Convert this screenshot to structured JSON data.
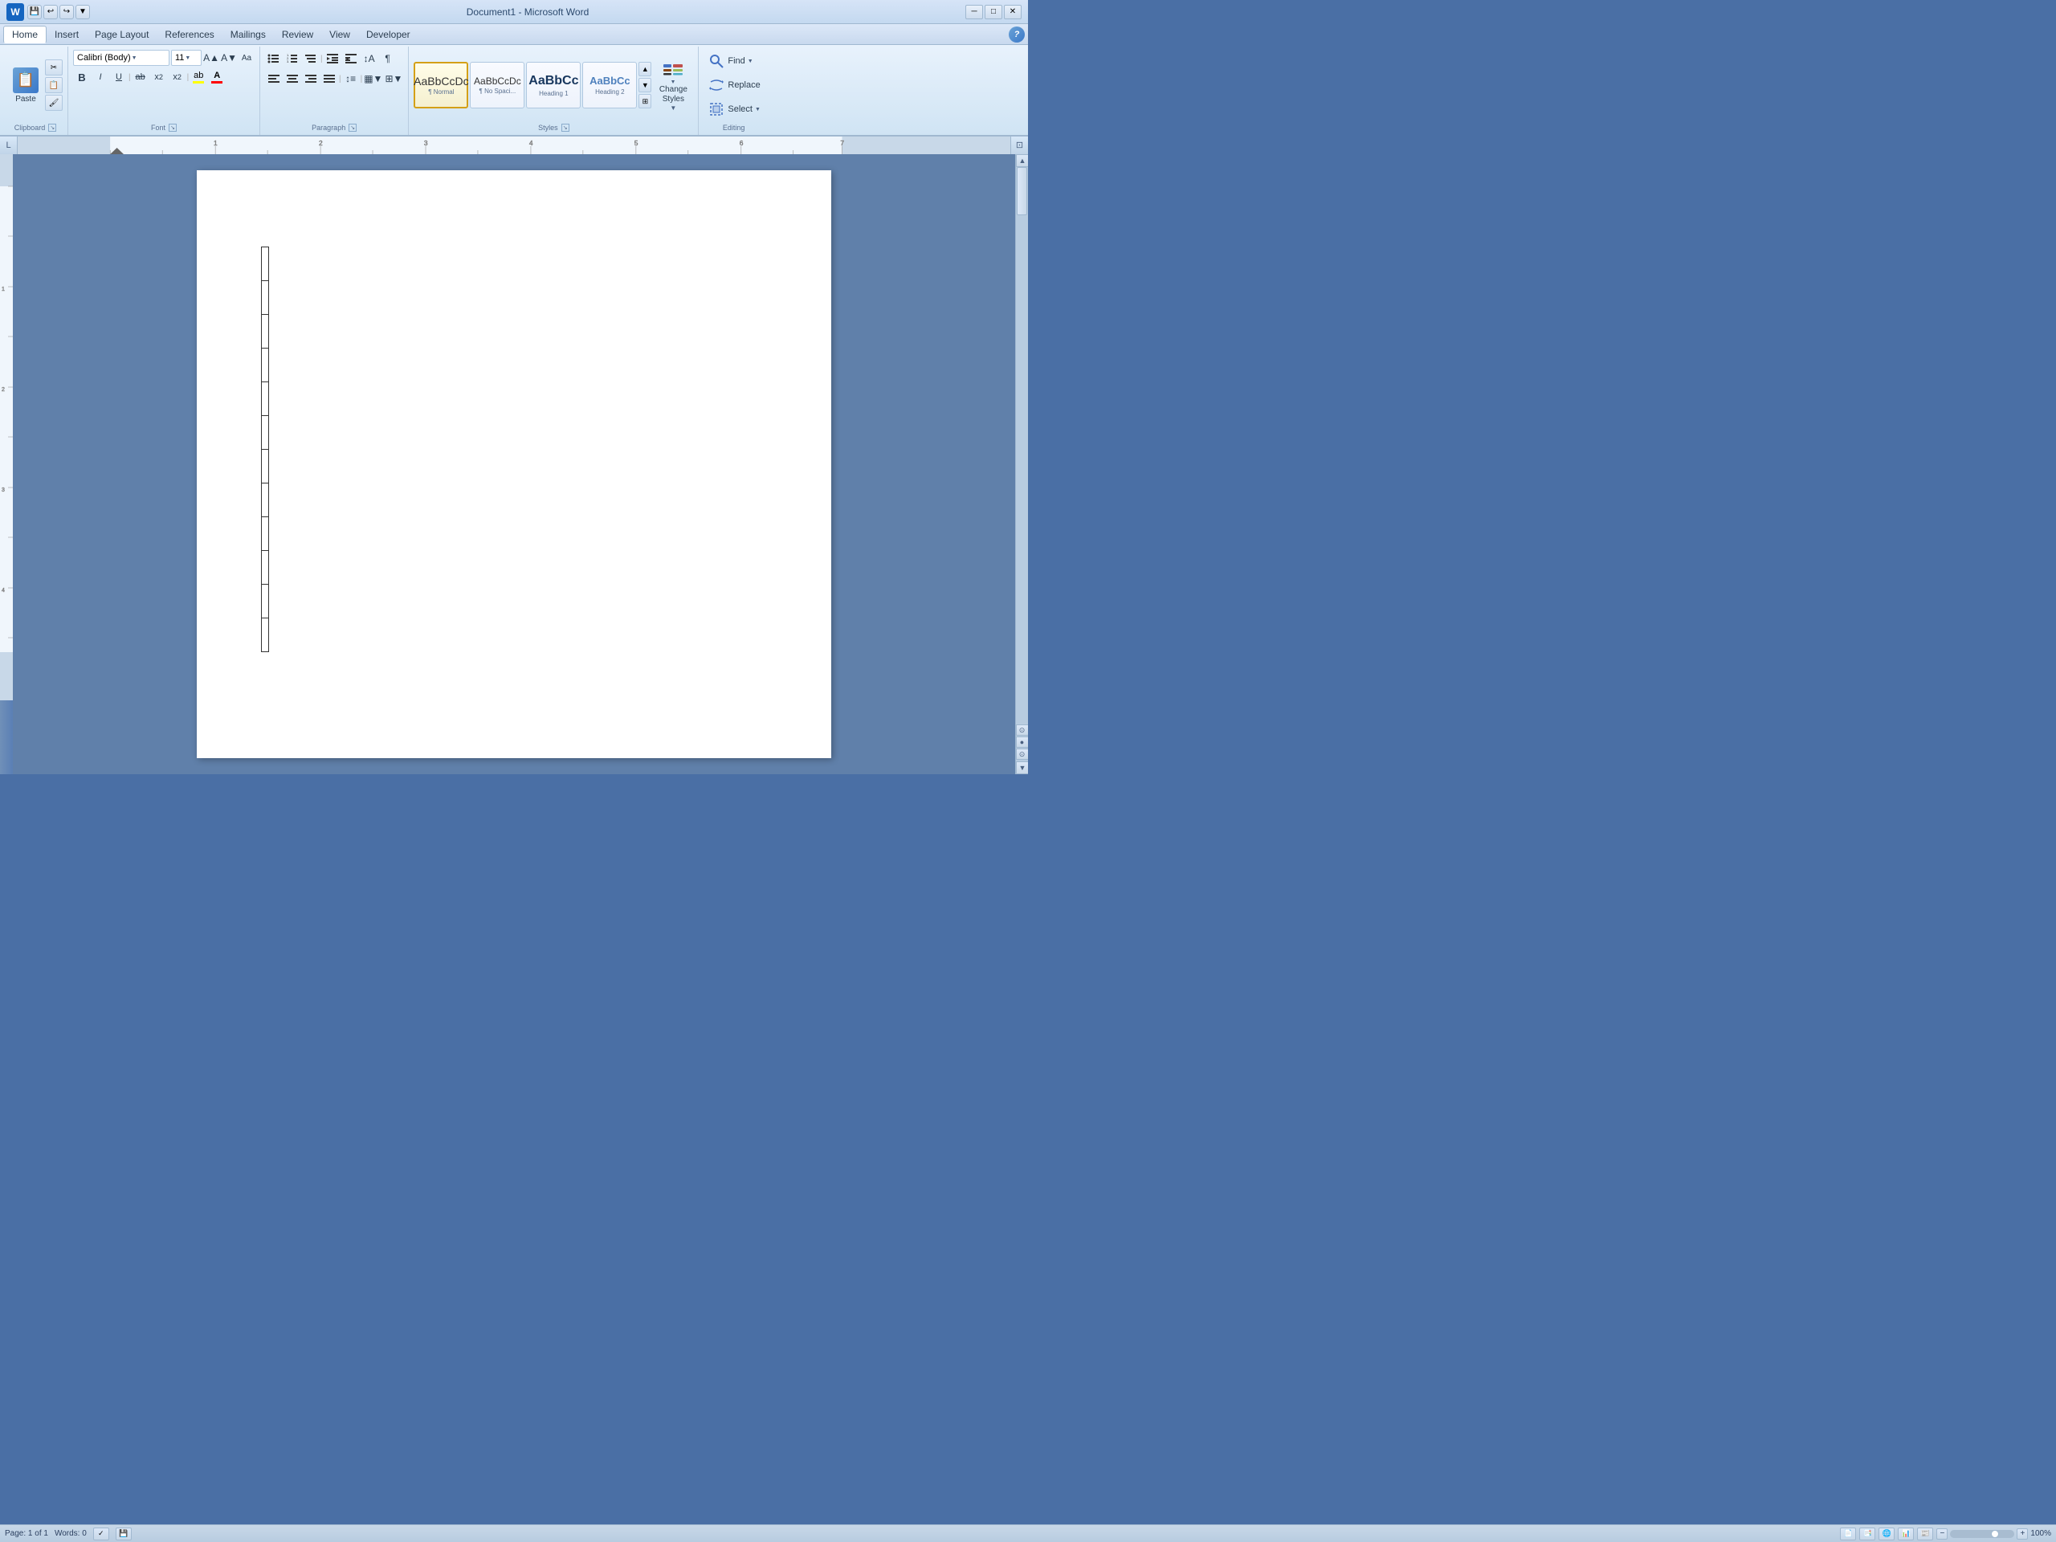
{
  "title_bar": {
    "title": "Document1 - Microsoft Word",
    "app_icon": "W",
    "save_label": "💾",
    "undo_label": "↩",
    "redo_label": "↪",
    "minimize_label": "─",
    "maximize_label": "□",
    "close_label": "✕"
  },
  "menu": {
    "items": [
      {
        "label": "Home",
        "active": true
      },
      {
        "label": "Insert"
      },
      {
        "label": "Page Layout"
      },
      {
        "label": "References"
      },
      {
        "label": "Mailings"
      },
      {
        "label": "Review"
      },
      {
        "label": "View"
      },
      {
        "label": "Developer"
      }
    ]
  },
  "ribbon": {
    "clipboard": {
      "label": "Clipboard",
      "paste_label": "Paste",
      "cut_label": "✂",
      "copy_label": "📋",
      "format_painter_label": "🖌"
    },
    "font": {
      "label": "Font",
      "font_name": "Calibri (Body)",
      "font_size": "11",
      "grow_label": "A",
      "shrink_label": "A",
      "case_label": "Aa",
      "bold_label": "B",
      "italic_label": "I",
      "underline_label": "U",
      "strikethrough_label": "ab",
      "subscript_label": "x₂",
      "superscript_label": "x²",
      "font_color_label": "A",
      "highlight_label": "ab"
    },
    "paragraph": {
      "label": "Paragraph",
      "bullets_label": "≡",
      "numbering_label": "≡",
      "multilevel_label": "≡",
      "decrease_indent_label": "⇐",
      "increase_indent_label": "⇒",
      "sort_label": "↕",
      "show_marks_label": "¶",
      "align_left_label": "≡",
      "align_center_label": "≡",
      "align_right_label": "≡",
      "justify_label": "≡",
      "line_spacing_label": "↕",
      "shading_label": "▦",
      "borders_label": "⊞"
    },
    "styles": {
      "label": "Styles",
      "items": [
        {
          "preview": "AaBbCcDc",
          "name": "¶ Normal",
          "active": true
        },
        {
          "preview": "AaBbCcDc",
          "name": "¶ No Spaci..."
        },
        {
          "preview": "AaBbCc",
          "name": "Heading 1"
        },
        {
          "preview": "AaBbCc",
          "name": "Heading 2"
        }
      ],
      "change_styles_label": "Change\nStyles",
      "change_styles_arrow": "▼"
    },
    "editing": {
      "label": "Editing",
      "find_label": "Find",
      "find_arrow": "▼",
      "replace_label": "Replace",
      "select_label": "Select",
      "select_arrow": "▼"
    }
  },
  "document": {
    "table_rows": 12,
    "table_cols": 1
  },
  "status_bar": {
    "page_info": "Page: 1 of 1",
    "words_info": "Words: 0",
    "proofing_label": "✓",
    "zoom_percent": "100%",
    "view_buttons": [
      "📄",
      "📑",
      "🔍",
      "📊",
      "📰"
    ]
  }
}
